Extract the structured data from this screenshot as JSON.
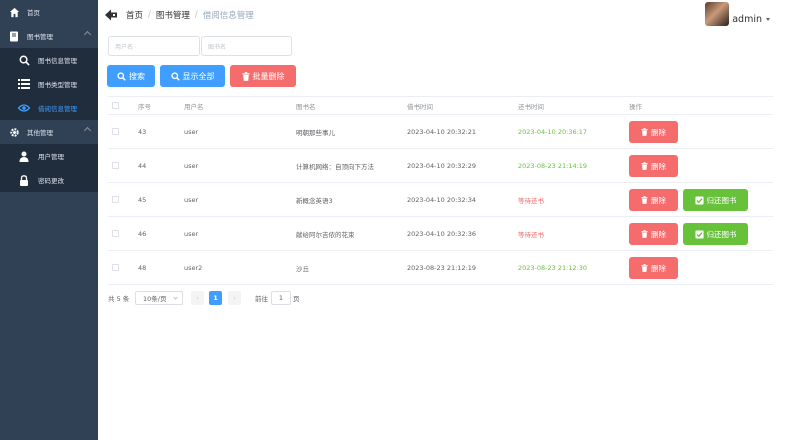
{
  "sidebar": {
    "items": [
      {
        "label": "首页",
        "icon": "home-icon"
      },
      {
        "label": "图书管理",
        "icon": "book-icon"
      },
      {
        "label": "图书信息管理",
        "icon": "search-icon"
      },
      {
        "label": "图书类型管理",
        "icon": "list-icon"
      },
      {
        "label": "借阅信息管理",
        "icon": "eye-icon"
      },
      {
        "label": "其他管理",
        "icon": "gear-icon"
      },
      {
        "label": "用户管理",
        "icon": "user-icon"
      },
      {
        "label": "密码更改",
        "icon": "lock-icon"
      }
    ]
  },
  "header": {
    "breadcrumb": [
      "首页",
      "图书管理",
      "借阅信息管理"
    ],
    "username": "admin"
  },
  "search": {
    "username_placeholder": "用户名",
    "bookname_placeholder": "图书名",
    "search_label": "搜索",
    "show_all_label": "显示全部",
    "batch_delete_label": "批量删除"
  },
  "table": {
    "columns": [
      "序号",
      "用户名",
      "图书名",
      "借书时间",
      "还书时间",
      "操作"
    ],
    "rows": [
      {
        "id": "43",
        "user": "user",
        "book": "明朝那些事儿",
        "borrow": "2023-04-10 20:32:21",
        "return": "2023-04-10 20:36:17",
        "returned": true
      },
      {
        "id": "44",
        "user": "user",
        "book": "计算机网络：自顶向下方法",
        "borrow": "2023-04-10 20:32:29",
        "return": "2023-08-23 21:14:19",
        "returned": true
      },
      {
        "id": "45",
        "user": "user",
        "book": "新概念英语3",
        "borrow": "2023-04-10 20:32:34",
        "return": "等待还书",
        "returned": false
      },
      {
        "id": "46",
        "user": "user",
        "book": "献给阿尔吉侬的花束",
        "borrow": "2023-04-10 20:32:36",
        "return": "等待还书",
        "returned": false
      },
      {
        "id": "48",
        "user": "user2",
        "book": "沙丘",
        "borrow": "2023-08-23 21:12:19",
        "return": "2023-08-23 21:12:30",
        "returned": true
      }
    ],
    "delete_label": "删除",
    "return_label": "归还图书"
  },
  "pagination": {
    "total": "共 5 条",
    "page_size": "10条/页",
    "current_page": "1",
    "goto_prefix": "前往",
    "goto_value": "1",
    "goto_suffix": "页"
  },
  "colors": {
    "sidebar_bg": "#304156",
    "primary": "#409eff",
    "danger": "#f56c6c",
    "success": "#67c23a"
  }
}
